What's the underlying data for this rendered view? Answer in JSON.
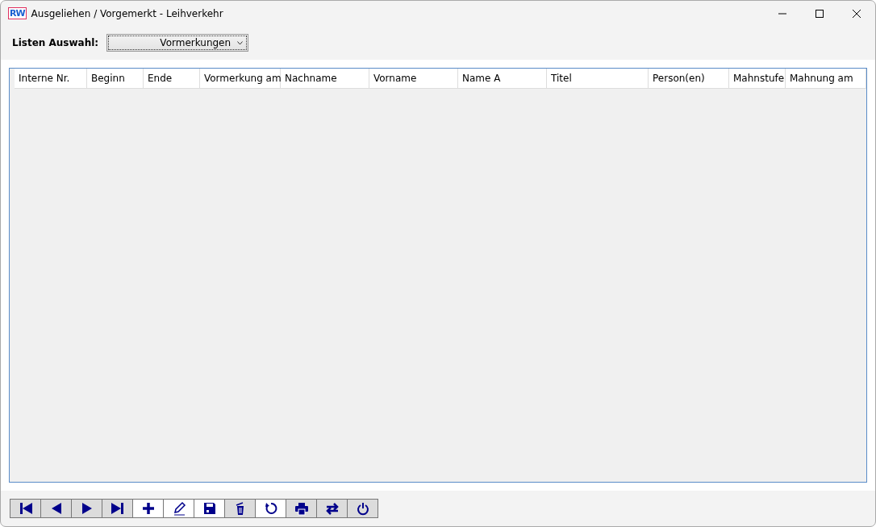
{
  "window": {
    "app_icon": "RW",
    "title": "Ausgeliehen / Vorgemerkt - Leihverkehr"
  },
  "list_selection": {
    "label": "Listen Auswahl:",
    "value": "Vormerkungen"
  },
  "table": {
    "columns": [
      "Interne Nr.",
      "Beginn",
      "Ende",
      "Vormerkung am",
      "Nachname",
      "Vorname",
      "Name A",
      "Titel",
      "Person(en)",
      "Mahnstufe",
      "Mahnung am"
    ]
  },
  "toolbar": [
    {
      "shaded": true
    },
    {
      "shaded": true
    },
    {
      "shaded": true
    },
    {
      "shaded": true
    },
    {
      "shaded": false
    },
    {
      "shaded": false
    },
    {
      "shaded": false
    },
    {
      "shaded": true
    },
    {
      "shaded": false
    },
    {
      "shaded": true
    },
    {
      "shaded": true
    },
    {
      "shaded": true
    }
  ]
}
